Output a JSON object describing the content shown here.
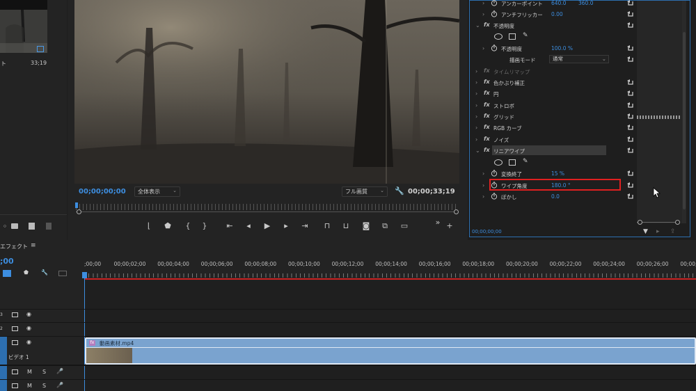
{
  "project": {
    "clip_label": "ト",
    "clip_duration": "33;19"
  },
  "program": {
    "current_timecode": "00;00;00;00",
    "fit_option": "全体表示",
    "resolution_option": "フル画質",
    "duration_timecode": "00;00;33;19"
  },
  "effect_controls": {
    "rows": [
      {
        "type": "param",
        "name": "アンカーポイント",
        "value": "640.0",
        "value2": "360.0"
      },
      {
        "type": "param",
        "name": "アンチフリッカー",
        "value": "0.00"
      },
      {
        "type": "effect",
        "name": "不透明度",
        "expanded": true
      },
      {
        "type": "masks"
      },
      {
        "type": "param",
        "name": "不透明度",
        "value": "100.0 %"
      },
      {
        "type": "blend",
        "name": "描画モード",
        "value": "通常"
      },
      {
        "type": "effect",
        "name": "タイムリマップ",
        "disabled": true
      },
      {
        "type": "effect",
        "name": "色かぶり補正"
      },
      {
        "type": "effect",
        "name": "円"
      },
      {
        "type": "effect",
        "name": "ストロボ"
      },
      {
        "type": "effect",
        "name": "グリッド"
      },
      {
        "type": "effect",
        "name": "RGB カーブ"
      },
      {
        "type": "effect",
        "name": "ノイズ"
      },
      {
        "type": "effect",
        "name": "リニアワイプ",
        "expanded": true,
        "selected": true
      },
      {
        "type": "masks"
      },
      {
        "type": "param",
        "name": "変換終了",
        "value": "15 %"
      },
      {
        "type": "param",
        "name": "ワイプ角度",
        "value": "180.0 °",
        "highlighted": true
      },
      {
        "type": "param",
        "name": "ぼかし",
        "value": "0.0"
      }
    ],
    "footer_timecode": "00;00;00;00"
  },
  "timeline": {
    "panel_title": "エフェクト",
    "current_time": ";00",
    "ruler_labels": [
      ";00;00",
      "00;00;02;00",
      "00;00;04;00",
      "00;00;06;00",
      "00;00;08;00",
      "00;00;10;00",
      "00;00;12;00",
      "00;00;14;00",
      "00;00;16;00",
      "00;00;18;00",
      "00;00;20;00",
      "00;00;22;00",
      "00;00;24;00",
      "00;00;26;00",
      "00;00;"
    ],
    "clip_name": "動画素材.mp4",
    "video1_label": "ビデオ 1",
    "track_m": "M",
    "track_s": "S",
    "fx_badge": "fx"
  },
  "colors": {
    "accent_blue": "#3d8ee0",
    "highlight_red": "#e02020",
    "clip_blue": "#7aa3cf",
    "playhead_red": "#c22"
  }
}
